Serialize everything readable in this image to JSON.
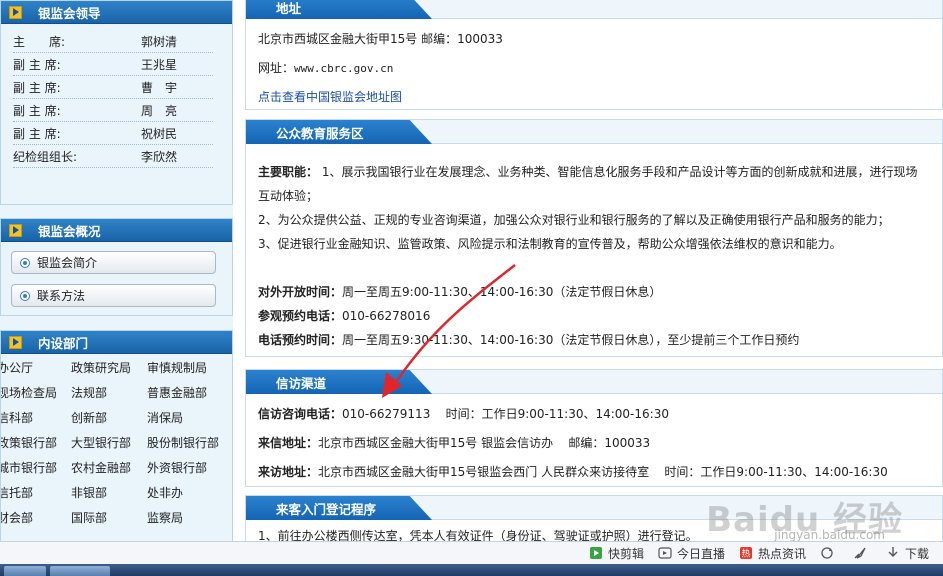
{
  "sidebar": {
    "leaders_title": "银监会领导",
    "leaders": [
      {
        "title": "主　　席:",
        "name": "郭树清"
      },
      {
        "title": "副 主 席:",
        "name": "王兆星"
      },
      {
        "title": "副 主 席:",
        "name": "曹　宇"
      },
      {
        "title": "副 主 席:",
        "name": "周　亮"
      },
      {
        "title": "副 主 席:",
        "name": "祝树民"
      },
      {
        "title": "纪检组组长:",
        "name": "李欣然"
      }
    ],
    "overview_title": "银监会概况",
    "overview_buttons": [
      "银监会简介",
      "联系方法"
    ],
    "depts_title": "内设部门",
    "depts": [
      [
        "办公厅",
        "政策研究局",
        "审慎规制局"
      ],
      [
        "现场检查局",
        "法规部",
        "普惠金融部"
      ],
      [
        "信科部",
        "创新部",
        "消保局"
      ],
      [
        "政策银行部",
        "大型银行部",
        "股份制银行部"
      ],
      [
        "城市银行部",
        "农村金融部",
        "外资银行部"
      ],
      [
        "信托部",
        "非银部",
        "处非办"
      ],
      [
        "财会部",
        "国际部",
        "监察局"
      ]
    ]
  },
  "address": {
    "title": "地址",
    "line": "北京市西城区金融大街甲15号  邮编：100033",
    "site_label": "网址：",
    "site": "www.cbrc.gov.cn",
    "map_link": "点击查看中国银监会地址图"
  },
  "education": {
    "title": "公众教育服务区",
    "duty_label": "主要职能：",
    "duty1a": "1、展示我国银行业在发展理念、业务种类、智能信息化服务手段和产品设计等方面的创新成就和进展，进行现场",
    "duty1b": "互动体验；",
    "duty2": "2、为公众提供公益、正规的专业咨询渠道，加强公众对银行业和银行服务的了解以及正确使用银行产品和服务的能力；",
    "duty3": "3、促进银行业金融知识、监管政策、风险提示和法制教育的宣传普及，帮助公众增强依法维权的意识和能力。",
    "open_label": "对外开放时间：",
    "open_value": "周一至周五9:00-11:30、14:00-16:30（法定节假日休息）",
    "visit_label": "参观预约电话：",
    "visit_value": "010-66278016",
    "phone_label": "电话预约时间：",
    "phone_value": "周一至周五9:30-11:30、14:00-16:30（法定节假日休息），至少提前三个工作日预约"
  },
  "petition": {
    "title": "信访渠道",
    "consult_label": "信访咨询电话：",
    "consult_value": "010-66279113",
    "consult_time_label": "时间：",
    "consult_time": "工作日9:00-11:30、14:00-16:30",
    "letter_label": "来信地址：",
    "letter_value": "北京市西城区金融大街甲15号 银监会信访办",
    "letter_zip": "邮编：100033",
    "visit_label": "来访地址：",
    "visit_value": "北京市西城区金融大街甲15号银监会西门 人民群众来访接待室",
    "visit_time_label": "时间：",
    "visit_time": "工作日9:00-11:30、14:00-16:30"
  },
  "guest": {
    "title": "来客入门登记程序",
    "line1": "1、前往办公楼西侧传达室，凭本人有效证件（身份证、驾驶证或护照）进行登记。"
  },
  "statusbar": {
    "items": [
      "快剪辑",
      "今日直播",
      "热点资讯",
      "下载"
    ]
  },
  "watermark": {
    "text": "Baidu 经验",
    "sub": "jingyan.baidu.com"
  },
  "colors": {
    "header_blue": "#1a63a8",
    "arrow_red": "#e0262c",
    "link_blue": "#1a4fa8"
  }
}
